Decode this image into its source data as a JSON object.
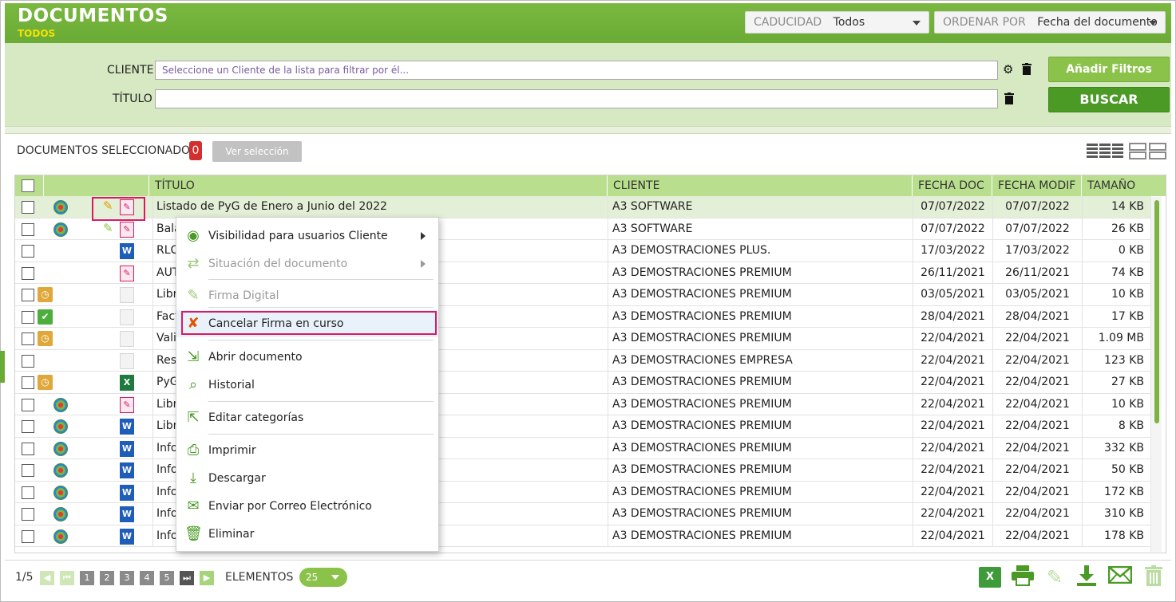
{
  "header": {
    "title": "DOCUMENTOS",
    "subtitle": "TODOS",
    "caducidad_label": "CADUCIDAD",
    "caducidad_value": "Todos",
    "ordenar_label": "ORDENAR POR",
    "ordenar_value": "Fecha del documento"
  },
  "filters": {
    "cliente_label": "CLIENTE",
    "cliente_placeholder": "Seleccione un Cliente de la lista para filtrar por él...",
    "titulo_label": "TÍTULO",
    "titulo_value": "",
    "add_filters_label": "Añadir Filtros",
    "search_label": "BUSCAR"
  },
  "selection": {
    "label": "DOCUMENTOS SELECCIONADOS",
    "count": "0",
    "view_button": "Ver selección"
  },
  "table": {
    "columns": [
      "TÍTULO",
      "CLIENTE",
      "FECHA DOC",
      "FECHA MODIF",
      "TAMAÑO"
    ],
    "rows": [
      {
        "status": "globe",
        "type": "pdf",
        "sig": "active",
        "title": "Listado de PyG de Enero a Junio del 2022",
        "client": "A3 SOFTWARE",
        "fdoc": "07/07/2022",
        "fmod": "07/07/2022",
        "size": "14 KB"
      },
      {
        "status": "globe",
        "type": "pdf",
        "sig": "done",
        "title": "Bala",
        "client": "A3 SOFTWARE",
        "fdoc": "07/07/2022",
        "fmod": "07/07/2022",
        "size": "26 KB"
      },
      {
        "status": "none",
        "type": "word",
        "sig": "",
        "title": "RLC",
        "client": "A3 DEMOSTRACIONES PLUS.",
        "fdoc": "17/03/2022",
        "fmod": "17/03/2022",
        "size": "0 KB"
      },
      {
        "status": "none",
        "type": "pdf",
        "sig": "",
        "title": "AUT",
        "client": "A3 DEMOSTRACIONES PREMIUM",
        "fdoc": "26/11/2021",
        "fmod": "26/11/2021",
        "size": "74 KB"
      },
      {
        "status": "clock",
        "type": "blank",
        "sig": "",
        "title": "Libr",
        "client": "A3 DEMOSTRACIONES PREMIUM",
        "fdoc": "03/05/2021",
        "fmod": "03/05/2021",
        "size": "10 KB"
      },
      {
        "status": "check",
        "type": "blank",
        "sig": "",
        "title": "Fact",
        "client": "A3 DEMOSTRACIONES PREMIUM",
        "fdoc": "28/04/2021",
        "fmod": "28/04/2021",
        "size": "17 KB"
      },
      {
        "status": "clock",
        "type": "blank",
        "sig": "",
        "title": "Vali",
        "client": "A3 DEMOSTRACIONES PREMIUM",
        "fdoc": "22/04/2021",
        "fmod": "22/04/2021",
        "size": "1.09 MB"
      },
      {
        "status": "none",
        "type": "blank",
        "sig": "",
        "title": "Resu",
        "client": "A3 DEMOSTRACIONES EMPRESA",
        "fdoc": "22/04/2021",
        "fmod": "22/04/2021",
        "size": "123 KB"
      },
      {
        "status": "clock",
        "type": "excel",
        "sig": "",
        "title": "PyG",
        "client": "A3 DEMOSTRACIONES PREMIUM",
        "fdoc": "22/04/2021",
        "fmod": "22/04/2021",
        "size": "27 KB"
      },
      {
        "status": "globe",
        "type": "pdf",
        "sig": "",
        "title": "Libr",
        "client": "A3 DEMOSTRACIONES PREMIUM",
        "fdoc": "22/04/2021",
        "fmod": "22/04/2021",
        "size": "10 KB"
      },
      {
        "status": "globe",
        "type": "word",
        "sig": "",
        "title": "Libr",
        "client": "A3 DEMOSTRACIONES PREMIUM",
        "fdoc": "22/04/2021",
        "fmod": "22/04/2021",
        "size": "8 KB"
      },
      {
        "status": "globe",
        "type": "word",
        "sig": "",
        "title": "Info",
        "client": "A3 DEMOSTRACIONES PREMIUM",
        "fdoc": "22/04/2021",
        "fmod": "22/04/2021",
        "size": "332 KB"
      },
      {
        "status": "globe",
        "type": "word",
        "sig": "",
        "title": "Info",
        "client": "A3 DEMOSTRACIONES PREMIUM",
        "fdoc": "22/04/2021",
        "fmod": "22/04/2021",
        "size": "50 KB"
      },
      {
        "status": "globe",
        "type": "word",
        "sig": "",
        "title": "Info",
        "client": "A3 DEMOSTRACIONES PREMIUM",
        "fdoc": "22/04/2021",
        "fmod": "22/04/2021",
        "size": "172 KB"
      },
      {
        "status": "globe",
        "type": "word",
        "sig": "",
        "title": "Info",
        "client": "A3 DEMOSTRACIONES PREMIUM",
        "fdoc": "22/04/2021",
        "fmod": "22/04/2021",
        "size": "310 KB"
      },
      {
        "status": "globe",
        "type": "word",
        "sig": "",
        "title": "Info",
        "client": "A3 DEMOSTRACIONES PREMIUM",
        "fdoc": "22/04/2021",
        "fmod": "22/04/2021",
        "size": "178 KB"
      }
    ]
  },
  "context_menu": {
    "items": [
      {
        "label": "Visibilidad para usuarios Cliente",
        "icon": "eye-icon",
        "submenu": true,
        "disabled": false
      },
      {
        "label": "Situación del documento",
        "icon": "workflow-icon",
        "submenu": true,
        "disabled": true
      },
      {
        "label": "Firma Digital",
        "icon": "signature-icon",
        "submenu": false,
        "disabled": true
      },
      {
        "label": "Cancelar Firma en curso",
        "icon": "cancel-signature-icon",
        "submenu": false,
        "disabled": false,
        "highlighted": true
      },
      {
        "label": "Abrir documento",
        "icon": "open-document-icon",
        "submenu": false,
        "disabled": false
      },
      {
        "label": "Historial",
        "icon": "history-icon",
        "submenu": false,
        "disabled": false
      },
      {
        "label": "Editar categorías",
        "icon": "edit-categories-icon",
        "submenu": false,
        "disabled": false
      },
      {
        "label": "Imprimir",
        "icon": "printer-icon",
        "submenu": false,
        "disabled": false
      },
      {
        "label": "Descargar",
        "icon": "download-icon",
        "submenu": false,
        "disabled": false
      },
      {
        "label": "Enviar por Correo Electrónico",
        "icon": "email-icon",
        "submenu": false,
        "disabled": false
      },
      {
        "label": "Eliminar",
        "icon": "trash-icon",
        "submenu": false,
        "disabled": false
      }
    ]
  },
  "footer": {
    "page_indicator": "1/5",
    "pages": [
      "1",
      "2",
      "3",
      "4",
      "5"
    ],
    "elements_label": "ELEMENTOS",
    "per_page": "25"
  },
  "colors": {
    "brand_green": "#6aab35",
    "accent_yellow": "#f2e300",
    "highlight_pink": "#d81b60"
  }
}
